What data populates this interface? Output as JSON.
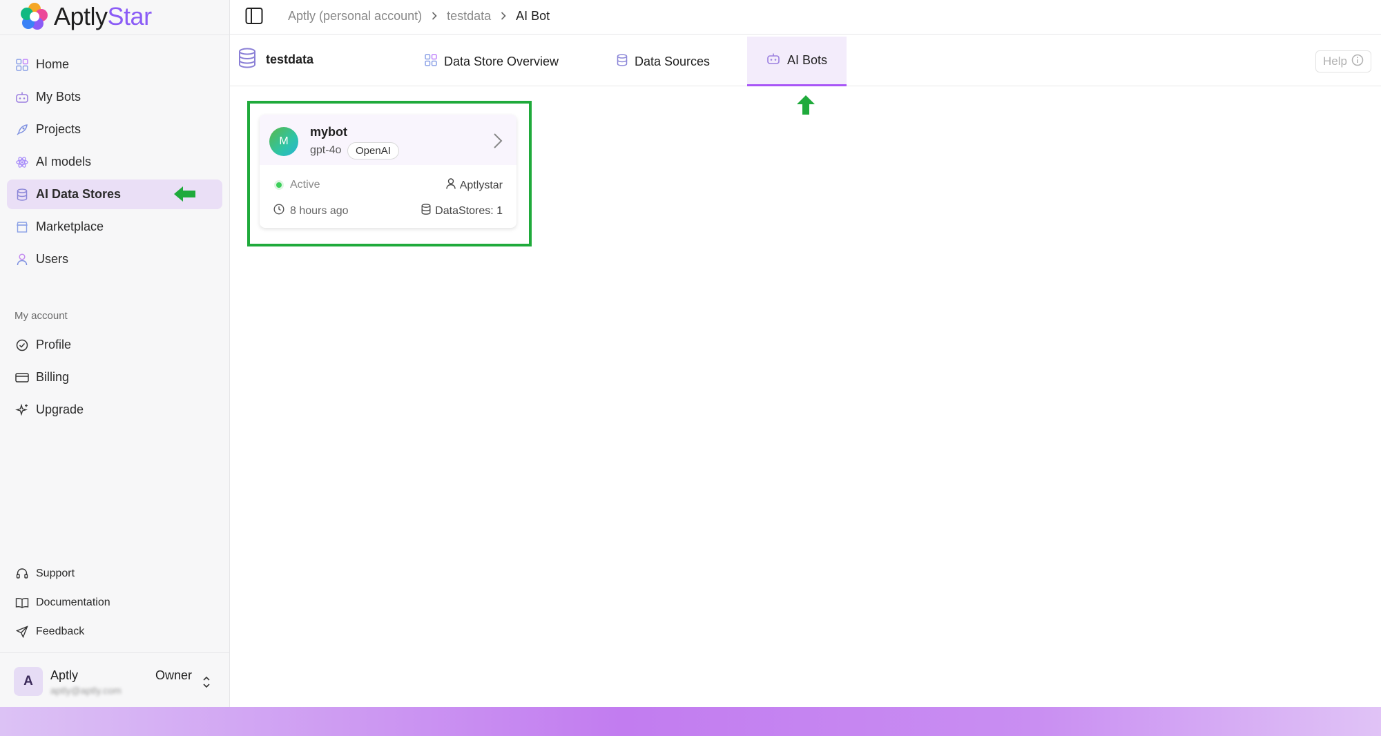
{
  "app": {
    "brand_prefix": "Aptly",
    "brand_suffix": "Star"
  },
  "sidebar": {
    "items": [
      {
        "label": "Home",
        "icon": "home-grid-icon"
      },
      {
        "label": "My Bots",
        "icon": "bot-icon"
      },
      {
        "label": "Projects",
        "icon": "rocket-icon"
      },
      {
        "label": "AI models",
        "icon": "atom-icon"
      },
      {
        "label": "AI Data Stores",
        "icon": "database-icon",
        "active": true
      },
      {
        "label": "Marketplace",
        "icon": "store-icon"
      },
      {
        "label": "Users",
        "icon": "user-icon"
      }
    ],
    "account_section": "My account",
    "account_items": [
      {
        "label": "Profile",
        "icon": "check-circle-icon"
      },
      {
        "label": "Billing",
        "icon": "credit-card-icon"
      },
      {
        "label": "Upgrade",
        "icon": "sparkles-icon"
      }
    ],
    "support_items": [
      {
        "label": "Support",
        "icon": "headset-icon"
      },
      {
        "label": "Documentation",
        "icon": "book-icon"
      },
      {
        "label": "Feedback",
        "icon": "send-icon"
      }
    ],
    "user": {
      "initial": "A",
      "name": "Aptly",
      "email": "aptly@aptly.com",
      "role": "Owner"
    }
  },
  "breadcrumb": {
    "account": "Aptly (personal account)",
    "store": "testdata",
    "current": "AI Bot"
  },
  "store_header": {
    "title": "testdata",
    "tabs": [
      {
        "label": "Data Store Overview",
        "icon": "grid-icon"
      },
      {
        "label": "Data Sources",
        "icon": "database-icon"
      },
      {
        "label": "AI Bots",
        "icon": "bot-icon",
        "active": true
      }
    ],
    "help_label": "Help"
  },
  "bot_card": {
    "initial": "M",
    "name": "mybot",
    "model": "gpt-4o",
    "provider": "OpenAI",
    "status": "Active",
    "owner": "Aptlystar",
    "updated": "8 hours ago",
    "datastores": "DataStores: 1"
  },
  "colors": {
    "accent": "#a855f7",
    "active_bg": "#eadff6",
    "annotation_green": "#1faa3b",
    "status_green": "#3ccf5a"
  }
}
